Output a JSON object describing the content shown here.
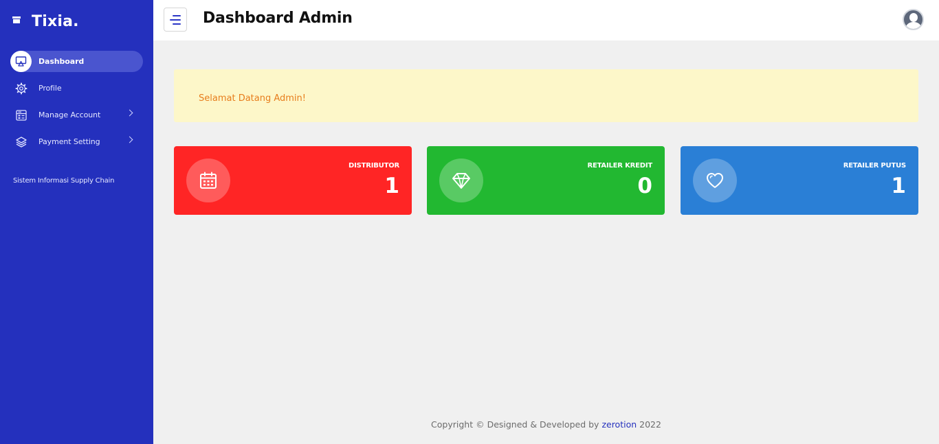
{
  "brand": {
    "name": "Tixia."
  },
  "header": {
    "title": "Dashboard Admin"
  },
  "sidebar": {
    "items": [
      {
        "label": "Dashboard",
        "icon": "monitor-icon",
        "active": true
      },
      {
        "label": "Profile",
        "icon": "gear-icon"
      },
      {
        "label": "Manage Account",
        "icon": "cash-register-icon",
        "has_submenu": true
      },
      {
        "label": "Payment Setting",
        "icon": "layers-icon",
        "has_submenu": true
      }
    ],
    "footer_text": "Sistem Informasi Supply Chain"
  },
  "alert": {
    "text": "Selamat Datang Admin!"
  },
  "cards": [
    {
      "label": "DISTRIBUTOR",
      "value": "1",
      "icon": "calendar-icon",
      "color": "#ff2525"
    },
    {
      "label": "RETAILER KREDIT",
      "value": "0",
      "icon": "diamond-icon",
      "color": "#22b831"
    },
    {
      "label": "RETAILER PUTUS",
      "value": "1",
      "icon": "heart-icon",
      "color": "#2a7fd6"
    }
  ],
  "footer": {
    "prefix": "Copyright © Designed & Developed by",
    "link": "zerotion",
    "year": "2022"
  },
  "colors": {
    "sidebar": "#2430bd",
    "alert_bg": "#fdf7c9",
    "alert_text": "#e77d1c"
  }
}
